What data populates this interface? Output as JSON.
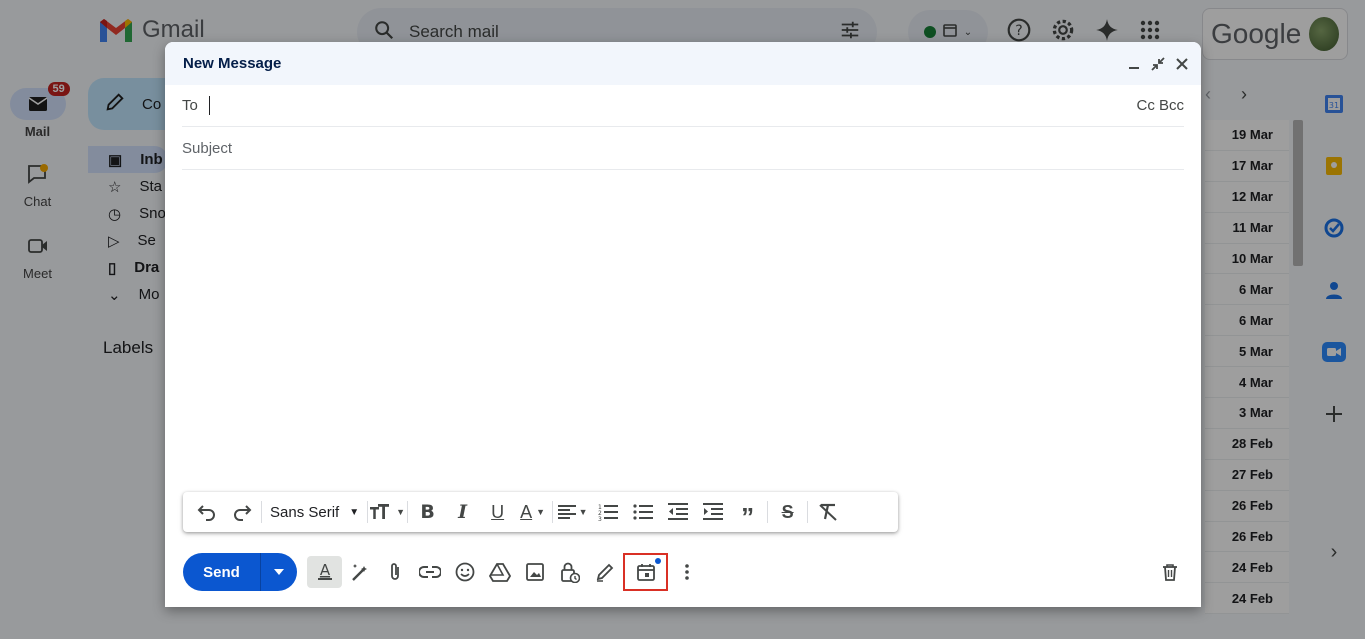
{
  "app": {
    "name": "Gmail",
    "google_wordmark": "Google"
  },
  "search": {
    "placeholder": "Search mail"
  },
  "rail": [
    {
      "label": "Mail",
      "badge": "59",
      "icon": "mail-icon"
    },
    {
      "label": "Chat",
      "icon": "chat-icon"
    },
    {
      "label": "Meet",
      "icon": "meet-icon"
    }
  ],
  "compose_button": {
    "label": "Co"
  },
  "nav": [
    {
      "label": "Inb",
      "icon": "inbox-icon"
    },
    {
      "label": "Sta",
      "icon": "star-icon"
    },
    {
      "label": "Sno",
      "icon": "clock-icon"
    },
    {
      "label": "Se",
      "icon": "send-icon"
    },
    {
      "label": "Dra",
      "icon": "draft-icon"
    },
    {
      "label": "Mo",
      "icon": "chevron-down-icon"
    }
  ],
  "labels_heading": "Labels",
  "dates": [
    "19 Mar",
    "17 Mar",
    "12 Mar",
    "11 Mar",
    "10 Mar",
    "6 Mar",
    "6 Mar",
    "5 Mar",
    "4 Mar",
    "3 Mar",
    "28 Feb",
    "27 Feb",
    "26 Feb",
    "26 Feb",
    "24 Feb",
    "24 Feb"
  ],
  "compose": {
    "title": "New Message",
    "to_label": "To",
    "to_value": "",
    "cc_bcc": "Cc Bcc",
    "subject_placeholder": "Subject",
    "font": "Sans Serif",
    "send_label": "Send"
  },
  "colors": {
    "primary": "#0b57d0",
    "highlight_box": "#d93025",
    "header_bg": "#f2f6fc"
  }
}
